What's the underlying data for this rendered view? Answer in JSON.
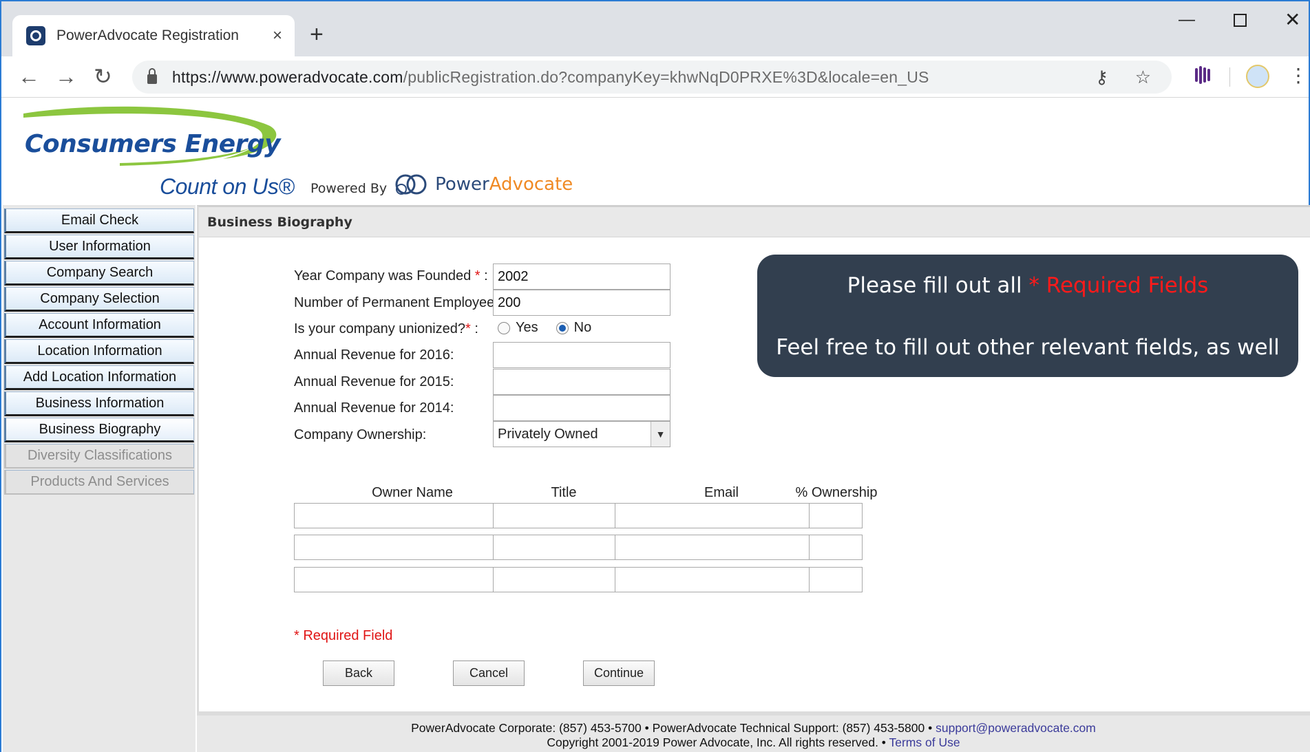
{
  "browser": {
    "tab_title": "PowerAdvocate Registration",
    "tab_close": "×",
    "new_tab": "+",
    "url_host": "https://www.poweradvocate.com",
    "url_path": "/publicRegistration.do?companyKey=khwNqD0PRXE%3D&locale=en_US",
    "window_minimize": "—",
    "window_close": "✕"
  },
  "header": {
    "logo_name": "Consumers Energy",
    "logo_tagline": "Count on Us®",
    "powered_by": "Powered By",
    "pa_power": "Power",
    "pa_advocate": "Advocate"
  },
  "sidebar": {
    "items": [
      {
        "label": "Email Check"
      },
      {
        "label": "User Information"
      },
      {
        "label": "Company Search"
      },
      {
        "label": "Company Selection"
      },
      {
        "label": "Account Information"
      },
      {
        "label": "Location Information"
      },
      {
        "label": "Add Location Information"
      },
      {
        "label": "Business Information"
      },
      {
        "label": "Business Biography"
      },
      {
        "label": "Diversity Classifications"
      },
      {
        "label": "Products And Services"
      }
    ]
  },
  "section": {
    "title": "Business Biography"
  },
  "form": {
    "year_founded_label": "Year Company was Founded",
    "year_founded_value": "2002",
    "employees_label": "Number of Permanent Employees",
    "employees_value": "200",
    "unionized_label": "Is your company unionized?",
    "unionized_yes": "Yes",
    "unionized_no": "No",
    "unionized_selected": "No",
    "revenue_2016_label": "Annual Revenue for 2016:",
    "revenue_2015_label": "Annual Revenue for 2015:",
    "revenue_2014_label": "Annual Revenue for 2014:",
    "ownership_label": "Company Ownership:",
    "ownership_value": "Privately Owned",
    "required_star": "*",
    "label_colon": ":"
  },
  "owners_table": {
    "headers": {
      "owner_name": "Owner Name",
      "title": "Title",
      "email": "Email",
      "pct": "% Ownership"
    }
  },
  "required_note": "* Required Field",
  "buttons": {
    "back": "Back",
    "cancel": "Cancel",
    "continue": "Continue"
  },
  "callout": {
    "line1_prefix": "Please fill out all",
    "line1_highlight": "* Required Fields",
    "line2": "Feel free to fill out other relevant fields, as well"
  },
  "footer": {
    "contact_text": "PowerAdvocate Corporate: (857) 453-5700 • PowerAdvocate Technical Support: (857) 453-5800 •",
    "support_email": "support@poweradvocate.com",
    "copyright": "Copyright 2001-2019 Power Advocate, Inc. All rights reserved. •",
    "terms": "Terms of Use"
  },
  "colors": {
    "required": "#e01515",
    "callout_bg": "#323f4f",
    "brand_blue": "#1a4e9b",
    "brand_green": "#8cc63f",
    "pa_orange": "#f08a24"
  }
}
